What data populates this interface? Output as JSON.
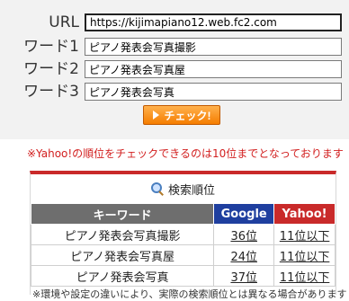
{
  "form": {
    "url_label": "URL",
    "url_value": "https://kijimapiano12.web.fc2.com",
    "word1_label": "ワード1",
    "word1_value": "ピアノ発表会写真撮影",
    "word2_label": "ワード2",
    "word2_value": "ピアノ発表会写真屋",
    "word3_label": "ワード3",
    "word3_value": "ピアノ発表会写真",
    "check_button": "チェック!"
  },
  "notice": "※Yahoo!の順位をチェックできるのは10位までとなっております",
  "results": {
    "title": "検索順位",
    "headers": {
      "keyword": "キーワード",
      "google": "Google",
      "yahoo": "Yahoo!"
    },
    "rows": [
      {
        "keyword": "ピアノ発表会写真撮影",
        "google": "36位",
        "yahoo": "11位以下"
      },
      {
        "keyword": "ピアノ発表会写真屋",
        "google": "24位",
        "yahoo": "11位以下"
      },
      {
        "keyword": "ピアノ発表会写真",
        "google": "37位",
        "yahoo": "11位以下"
      }
    ],
    "footnote": "※環境や設定の違いにより、実際の検索順位とは異なる場合があります"
  },
  "colors": {
    "button_orange": "#f57d00",
    "notice_red": "#d21f1f",
    "google_blue": "#1f3f9f",
    "yahoo_red": "#c92a2a",
    "keyword_gray": "#6e6e6e"
  },
  "icons": {
    "title_icon": "magnifier-icon",
    "button_icon": "play-arrow-icon"
  }
}
